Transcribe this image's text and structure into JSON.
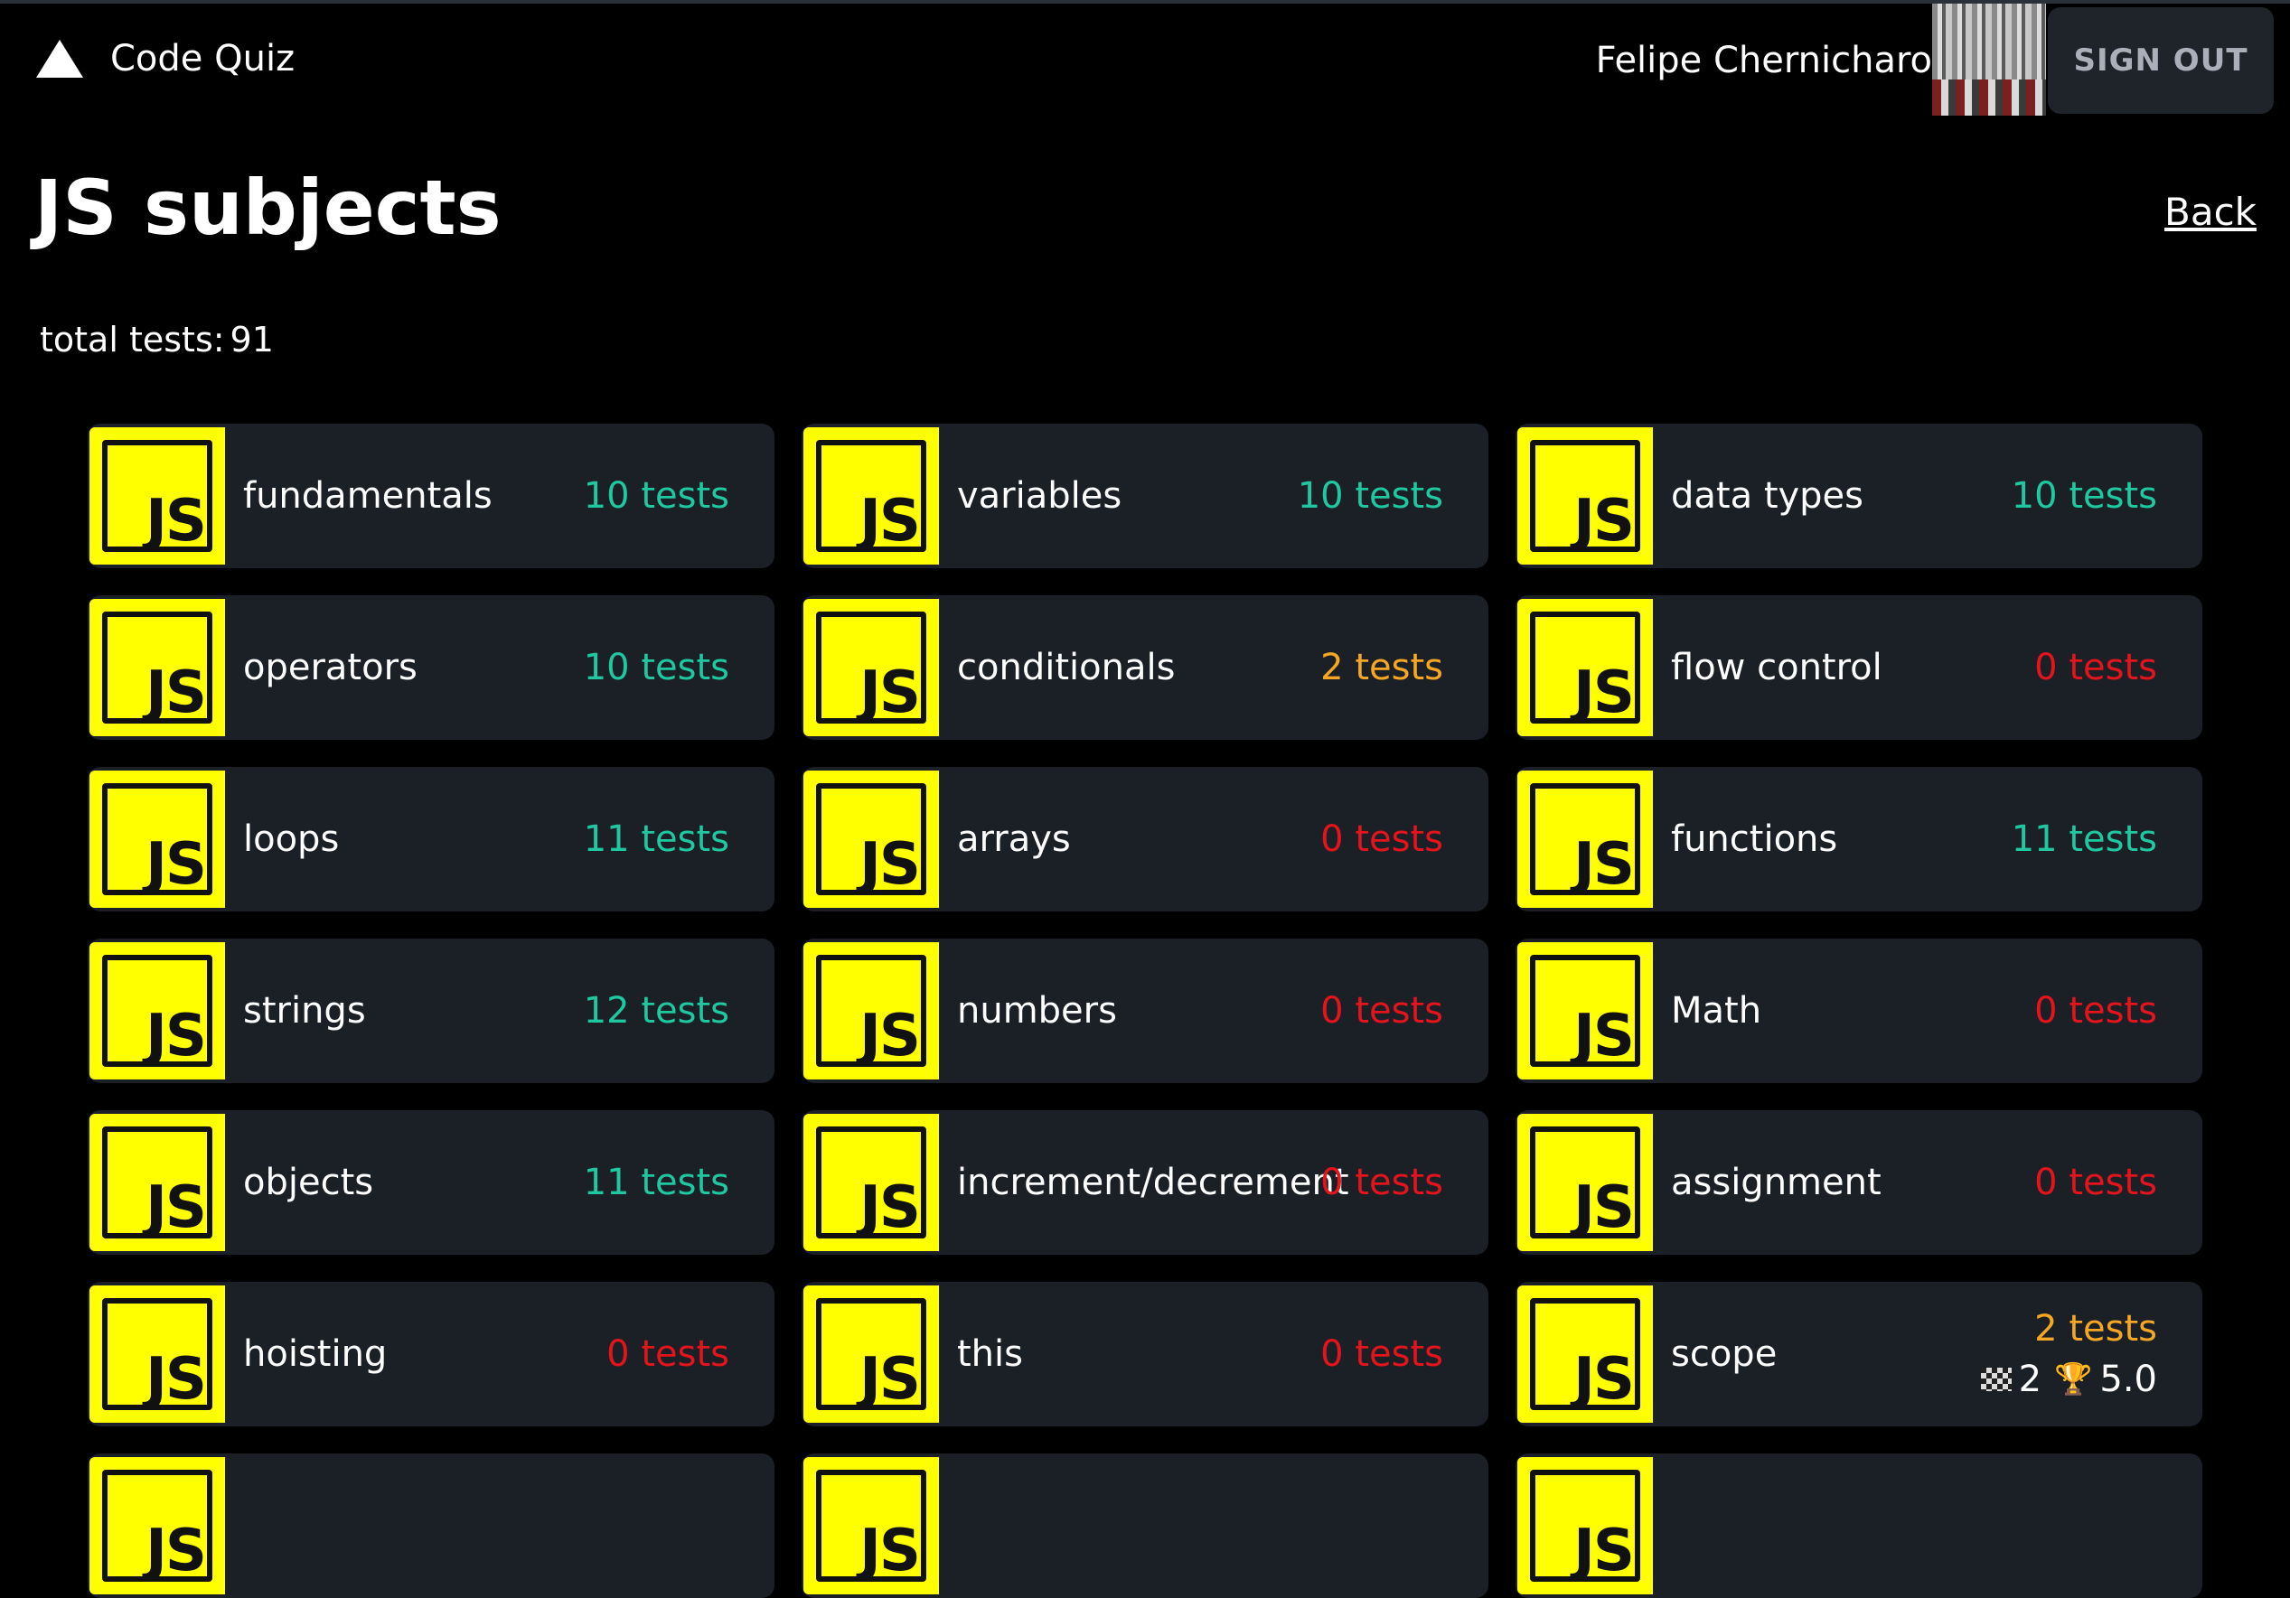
{
  "header": {
    "app_title": "Code Quiz",
    "user_name": "Felipe Chernicharo",
    "sign_out_label": "SIGN OUT"
  },
  "page": {
    "title": "JS subjects",
    "back_label": "Back",
    "total_label": "total tests:",
    "total_value": "91"
  },
  "colors": {
    "green": "#1fc8a0",
    "orange": "#f5a623",
    "red": "#e3141b",
    "js_yellow": "#ffff00",
    "card_bg": "#1b1f26"
  },
  "subjects": [
    {
      "name": "fundamentals",
      "count": "10 tests",
      "status": "green"
    },
    {
      "name": "variables",
      "count": "10 tests",
      "status": "green"
    },
    {
      "name": "data types",
      "count": "10 tests",
      "status": "green"
    },
    {
      "name": "operators",
      "count": "10 tests",
      "status": "green"
    },
    {
      "name": "conditionals",
      "count": "2 tests",
      "status": "orange"
    },
    {
      "name": "flow control",
      "count": "0 tests",
      "status": "red"
    },
    {
      "name": "loops",
      "count": "11 tests",
      "status": "green"
    },
    {
      "name": "arrays",
      "count": "0 tests",
      "status": "red"
    },
    {
      "name": "functions",
      "count": "11 tests",
      "status": "green"
    },
    {
      "name": "strings",
      "count": "12 tests",
      "status": "green"
    },
    {
      "name": "numbers",
      "count": "0 tests",
      "status": "red"
    },
    {
      "name": "Math",
      "count": "0 tests",
      "status": "red"
    },
    {
      "name": "objects",
      "count": "11 tests",
      "status": "green"
    },
    {
      "name": "increment/decrement",
      "count": "0 tests",
      "status": "red"
    },
    {
      "name": "assignment",
      "count": "0 tests",
      "status": "red"
    },
    {
      "name": "hoisting",
      "count": "0 tests",
      "status": "red"
    },
    {
      "name": "this",
      "count": "0 tests",
      "status": "red"
    },
    {
      "name": "scope",
      "count": "2 tests",
      "status": "orange",
      "attempts": "2",
      "score": "5.0"
    },
    {
      "name": "",
      "count": "",
      "status": "red"
    },
    {
      "name": "",
      "count": "",
      "status": "orange"
    },
    {
      "name": "",
      "count": "",
      "status": "red"
    }
  ],
  "js_logo_text": "JS"
}
